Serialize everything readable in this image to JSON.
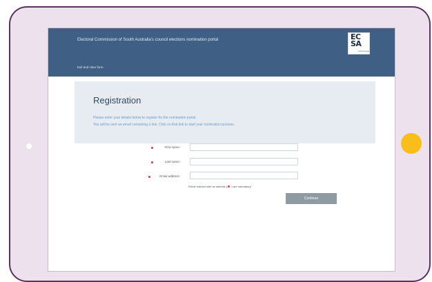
{
  "portal": {
    "title": "Electoral Commission of South Australia's council elections nomination portal",
    "exit_link": "Exit and clear form",
    "logo_text": "EC SA",
    "logo_sub": "ecsa.sa.gov.au"
  },
  "registration": {
    "title": "Registration",
    "line1": "Please enter your details below to register for the nomination portal.",
    "line2": "You will be sent an email containing a link. Click on that link to start your nomination process."
  },
  "form": {
    "first_name_label": "First name:",
    "last_name_label": "Last name:",
    "email_label": "Email address:",
    "first_name_value": "",
    "last_name_value": "",
    "email_value": "",
    "mandatory_note_before": "Fields marked with an asterisk (",
    "mandatory_note_after": " ) are mandatory.",
    "continue_label": "Continue"
  },
  "colors": {
    "header": "#3f5f84",
    "frame": "#5b2f63",
    "frame_fill": "#ece1ec",
    "home_button": "#f9bd1c",
    "required": "#d83a3a",
    "button": "#8f9ba3"
  }
}
